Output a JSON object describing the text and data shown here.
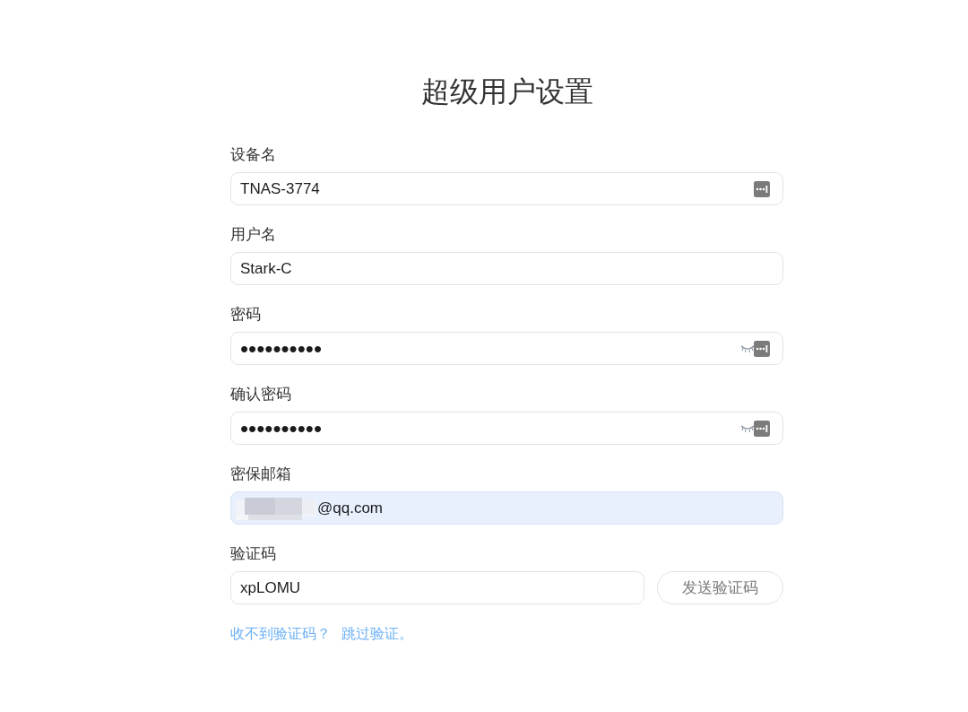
{
  "title": "超级用户设置",
  "fields": [
    {
      "label": "设备名",
      "kind": "text",
      "value": "TNAS-3774",
      "autofilled": false,
      "redacted": false,
      "manager_icon": true
    },
    {
      "label": "用户名",
      "kind": "text",
      "value": "Stark-C",
      "autofilled": false,
      "redacted": false,
      "manager_icon": false
    },
    {
      "label": "密码",
      "kind": "password",
      "value": "••••••••••",
      "revealed": false,
      "autofilled": false,
      "redacted": false,
      "manager_icon": true
    },
    {
      "label": "确认密码",
      "kind": "password",
      "value": "••••••••••",
      "revealed": false,
      "autofilled": false,
      "redacted": false,
      "manager_icon": true
    },
    {
      "label": "密保邮箱",
      "kind": "text",
      "value": "@qq.com",
      "autofilled": true,
      "redacted": true,
      "manager_icon": false
    },
    {
      "label": "验证码",
      "kind": "text",
      "value": "xpLOMU",
      "autofilled": false,
      "redacted": false,
      "manager_icon": false,
      "button": "发送验证码"
    }
  ],
  "footer": {
    "help_text": "收不到验证码？",
    "skip_link": "跳过验证。"
  }
}
